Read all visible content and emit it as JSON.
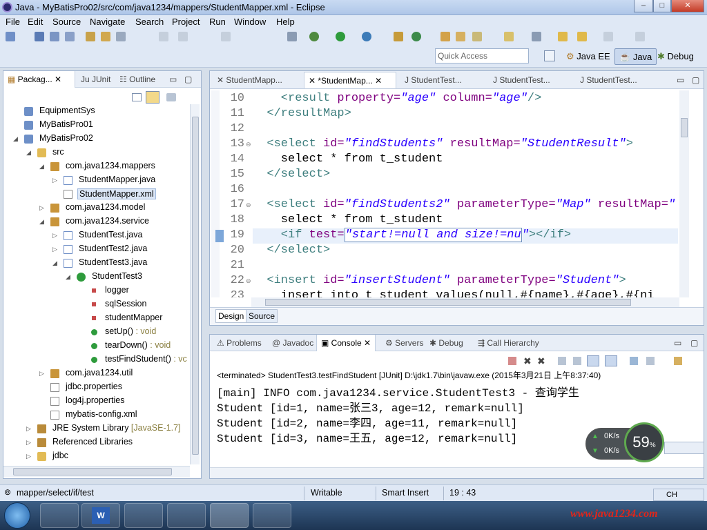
{
  "window": {
    "title": "Java - MyBatisPro02/src/com/java1234/mappers/StudentMapper.xml - Eclipse",
    "min": "–",
    "max": "□",
    "close": "✕"
  },
  "menu": [
    "File",
    "Edit",
    "Source",
    "Navigate",
    "Search",
    "Project",
    "Run",
    "Window",
    "Help"
  ],
  "quick_access": {
    "placeholder": "Quick Access"
  },
  "perspectives": {
    "javaee": "Java EE",
    "java": "Java",
    "debug": "Debug"
  },
  "left_tabs": {
    "package": "Packag...",
    "junit": "JUnit",
    "outline": "Outline"
  },
  "tree": [
    {
      "label": "EquipmentSys",
      "depth": 0,
      "icon": "project-icon"
    },
    {
      "label": "MyBatisPro01",
      "depth": 0,
      "icon": "project-icon"
    },
    {
      "label": "MyBatisPro02",
      "depth": 0,
      "icon": "project-icon",
      "open": true
    },
    {
      "label": "src",
      "depth": 1,
      "icon": "folder-icon",
      "open": true
    },
    {
      "label": "com.java1234.mappers",
      "depth": 2,
      "icon": "package-icon",
      "open": true
    },
    {
      "label": "StudentMapper.java",
      "depth": 3,
      "icon": "java-file-icon"
    },
    {
      "label": "StudentMapper.xml",
      "depth": 3,
      "icon": "xml-file-icon",
      "selected": true
    },
    {
      "label": "com.java1234.model",
      "depth": 2,
      "icon": "package-icon"
    },
    {
      "label": "com.java1234.service",
      "depth": 2,
      "icon": "package-icon",
      "open": true
    },
    {
      "label": "StudentTest.java",
      "depth": 3,
      "icon": "java-file-icon"
    },
    {
      "label": "StudentTest2.java",
      "depth": 3,
      "icon": "java-file-icon"
    },
    {
      "label": "StudentTest3.java",
      "depth": 3,
      "icon": "java-file-icon",
      "open": true
    },
    {
      "label": "StudentTest3",
      "depth": 4,
      "icon": "class-icon",
      "open": true
    },
    {
      "label": "logger",
      "depth": 5,
      "icon": "field-icon"
    },
    {
      "label": "sqlSession",
      "depth": 5,
      "icon": "field-icon"
    },
    {
      "label": "studentMapper",
      "depth": 5,
      "icon": "field-icon"
    },
    {
      "label": "setUp()",
      "suffix": " : void",
      "depth": 5,
      "icon": "method-icon"
    },
    {
      "label": "tearDown()",
      "suffix": " : void",
      "depth": 5,
      "icon": "method-icon"
    },
    {
      "label": "testFindStudent()",
      "suffix": " : vc",
      "depth": 5,
      "icon": "method-icon"
    },
    {
      "label": "com.java1234.util",
      "depth": 2,
      "icon": "package-icon"
    },
    {
      "label": "jdbc.properties",
      "depth": 2,
      "icon": "file-icon"
    },
    {
      "label": "log4j.properties",
      "depth": 2,
      "icon": "file-icon"
    },
    {
      "label": "mybatis-config.xml",
      "depth": 2,
      "icon": "xml-file-icon"
    },
    {
      "label": "JRE System Library",
      "suffix": " [JavaSE-1.7]",
      "depth": 1,
      "icon": "library-icon"
    },
    {
      "label": "Referenced Libraries",
      "depth": 1,
      "icon": "library-icon"
    },
    {
      "label": "jdbc",
      "depth": 1,
      "icon": "folder-icon"
    }
  ],
  "editor_tabs": [
    "StudentMapp...",
    "*StudentMap...",
    "StudentTest...",
    "StudentTest...",
    "StudentTest..."
  ],
  "code_lines": [
    {
      "n": "10",
      "segs": [
        [
          "t",
          "    <result "
        ],
        [
          "a",
          "property="
        ],
        [
          "v",
          "\"age\""
        ],
        [
          "a",
          " column="
        ],
        [
          "v",
          "\"age\""
        ],
        [
          "t",
          "/>"
        ]
      ]
    },
    {
      "n": "11",
      "segs": [
        [
          "t",
          "  </resultMap>"
        ]
      ]
    },
    {
      "n": "12",
      "segs": []
    },
    {
      "n": "13",
      "fold": true,
      "segs": [
        [
          "t",
          "  <select "
        ],
        [
          "a",
          "id="
        ],
        [
          "v",
          "\"findStudents\""
        ],
        [
          "a",
          " resultMap="
        ],
        [
          "v",
          "\"StudentResult\""
        ],
        [
          "t",
          ">"
        ]
      ]
    },
    {
      "n": "14",
      "segs": [
        [
          "p",
          "    select * from t_student"
        ]
      ]
    },
    {
      "n": "15",
      "segs": [
        [
          "t",
          "  </select>"
        ]
      ]
    },
    {
      "n": "16",
      "segs": []
    },
    {
      "n": "17",
      "fold": true,
      "segs": [
        [
          "t",
          "  <select "
        ],
        [
          "a",
          "id="
        ],
        [
          "v",
          "\"findStudents2\""
        ],
        [
          "a",
          " parameterType="
        ],
        [
          "v",
          "\"Map\""
        ],
        [
          "a",
          " resultMap="
        ],
        [
          "v",
          "\""
        ]
      ]
    },
    {
      "n": "18",
      "segs": [
        [
          "p",
          "    select * from t_student"
        ]
      ]
    },
    {
      "n": "19",
      "current": true,
      "segs": [
        [
          "t",
          "    <if "
        ],
        [
          "a",
          "test="
        ],
        [
          "v",
          "\"start!=null and size!=nu"
        ],
        [
          "v",
          "\""
        ],
        [
          "t",
          "></if>"
        ]
      ]
    },
    {
      "n": "20",
      "segs": [
        [
          "t",
          "  </select>"
        ]
      ]
    },
    {
      "n": "21",
      "segs": []
    },
    {
      "n": "22",
      "fold": true,
      "segs": [
        [
          "t",
          "  <insert "
        ],
        [
          "a",
          "id="
        ],
        [
          "v",
          "\"insertStudent\""
        ],
        [
          "a",
          " parameterType="
        ],
        [
          "v",
          "\"Student\""
        ],
        [
          "t",
          ">"
        ]
      ]
    },
    {
      "n": "23",
      "segs": [
        [
          "p",
          "    insert into t_student values(null,#{name},#{age},#{ni"
        ]
      ]
    }
  ],
  "editor_bottom_tabs": {
    "design": "Design",
    "source": "Source"
  },
  "console_tabs": [
    "Problems",
    "Javadoc",
    "Console",
    "Servers",
    "Debug",
    "Call Hierarchy"
  ],
  "console": {
    "header": "<terminated> StudentTest3.testFindStudent [JUnit] D:\\jdk1.7\\bin\\javaw.exe (2015年3月21日 上午8:37:40)",
    "lines": [
      "[main] INFO com.java1234.service.StudentTest3 - 查询学生",
      "Student [id=1, name=张三3, age=12, remark=null]",
      "Student [id=2, name=李四, age=11, remark=null]",
      "Student [id=3, name=王五, age=12, remark=null]"
    ]
  },
  "net_widget": {
    "up": "0K/s",
    "down": "0K/s",
    "percent": "59",
    "unit": "%"
  },
  "status": {
    "path": "mapper/select/if/test",
    "writable": "Writable",
    "mode": "Smart Insert",
    "position": "19 : 43"
  },
  "tray": {
    "lang": "CH",
    "watermark": "www.java1234.com"
  },
  "colors": {
    "tag": "#3f7f7f",
    "attr": "#7f007f",
    "value": "#2a00ff",
    "selection": "#c5d7ef"
  }
}
